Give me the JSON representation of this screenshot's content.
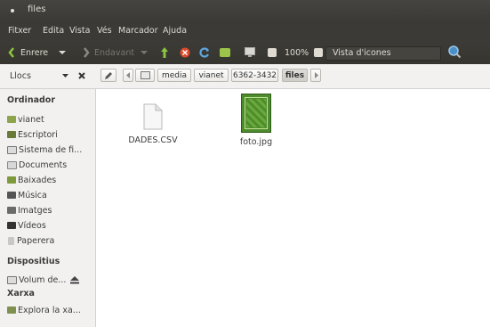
{
  "window": {
    "title": "files"
  },
  "menu": [
    "Fitxer",
    "Edita",
    "Vista",
    "Vés",
    "Marcador",
    "Ajuda"
  ],
  "toolbar": {
    "back_label": "Enrere",
    "forward_label": "Endavant",
    "zoom": "100%",
    "view_mode": "Vista d'icones"
  },
  "location": {
    "label": "Llocs"
  },
  "path": [
    "media",
    "vianet",
    "6362-3432",
    "files"
  ],
  "sidebar": {
    "sections": [
      {
        "header": "Ordinador",
        "items": [
          "vianet",
          "Escriptori",
          "Sistema de fi...",
          "Documents",
          "Baixades",
          "Música",
          "Imatges",
          "Vídeos",
          "Paperera"
        ]
      },
      {
        "header": "Dispositius",
        "items": [
          "Volum de..."
        ]
      },
      {
        "header": "Xarxa",
        "items": [
          "Explora la xa..."
        ]
      }
    ]
  },
  "files": [
    {
      "name": "DADES.CSV",
      "type": "document-icon"
    },
    {
      "name": "foto.jpg",
      "type": "image-thumbnail"
    }
  ],
  "colors": {
    "accent_green": "#8cc63f",
    "close_red": "#df4a2a",
    "back_orange": "#f07746"
  }
}
